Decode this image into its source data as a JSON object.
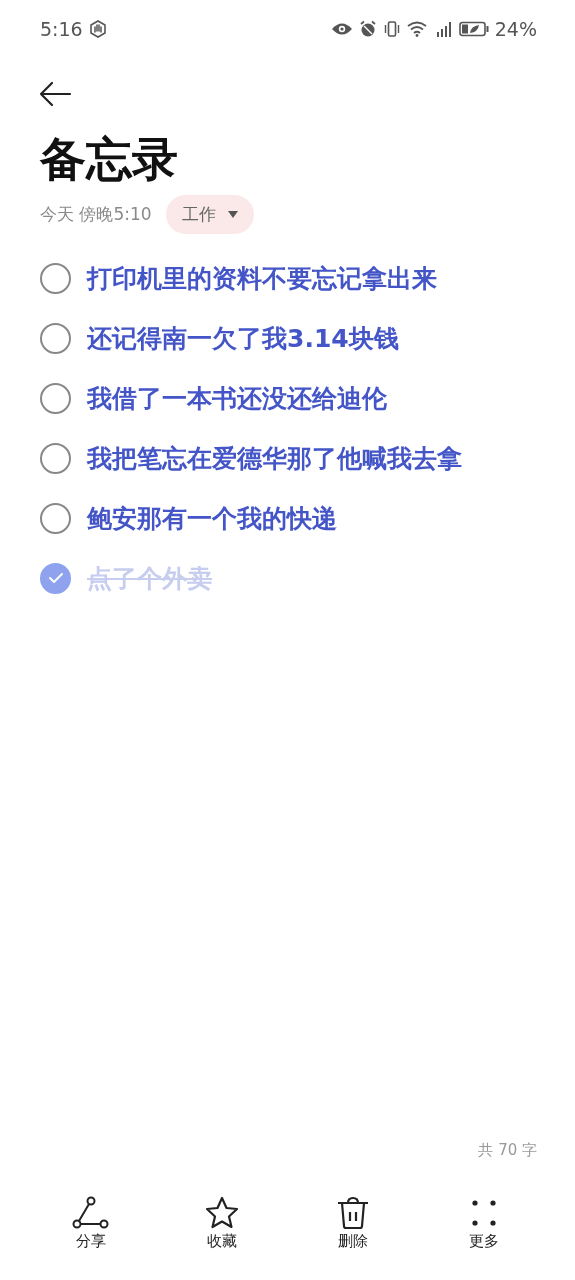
{
  "status_bar": {
    "time": "5:16",
    "battery": "24%"
  },
  "title": "备忘录",
  "meta": {
    "date": "今天 傍晚5:10",
    "tag": "工作"
  },
  "items": [
    {
      "text": "打印机里的资料不要忘记拿出来",
      "checked": false
    },
    {
      "text": "还记得南一欠了我3.14块钱",
      "checked": false
    },
    {
      "text": "我借了一本书还没还给迪伦",
      "checked": false
    },
    {
      "text": "我把笔忘在爱德华那了他喊我去拿",
      "checked": false
    },
    {
      "text": "鲍安那有一个我的快递",
      "checked": false
    },
    {
      "text": "点了个外卖",
      "checked": true
    }
  ],
  "word_count": "共 70 字",
  "toolbar": [
    {
      "kind": "share",
      "label": "分享"
    },
    {
      "kind": "star",
      "label": "收藏"
    },
    {
      "kind": "delete",
      "label": "删除"
    },
    {
      "kind": "more",
      "label": "更多"
    }
  ]
}
